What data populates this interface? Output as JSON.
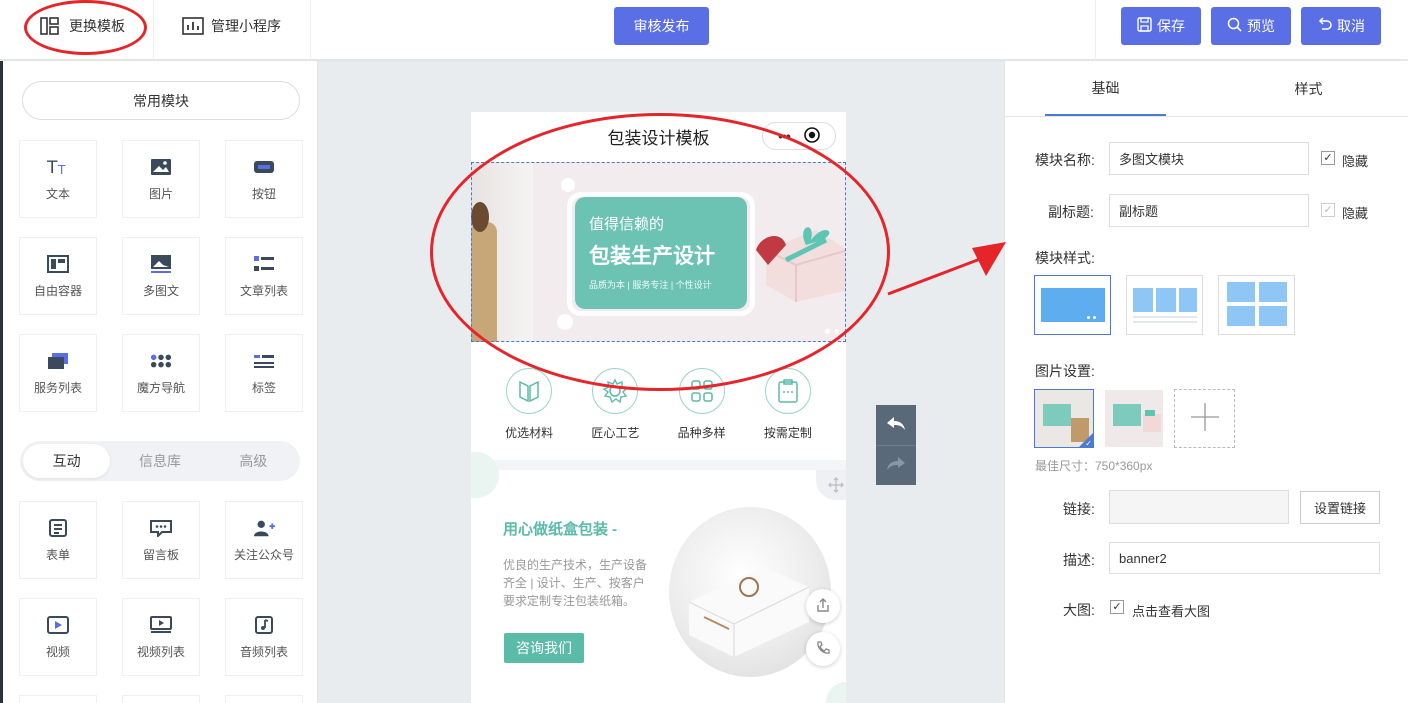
{
  "topbar": {
    "change_template": "更换模板",
    "manage_miniapp": "管理小程序",
    "publish": "审核发布",
    "save": "保存",
    "preview": "预览",
    "cancel": "取消"
  },
  "left": {
    "common_modules": "常用模块",
    "basic_items": [
      {
        "label": "文本",
        "icon": "text-icon"
      },
      {
        "label": "图片",
        "icon": "image-icon"
      },
      {
        "label": "按钮",
        "icon": "button-icon"
      },
      {
        "label": "自由容器",
        "icon": "container-icon"
      },
      {
        "label": "多图文",
        "icon": "multi-image-icon"
      },
      {
        "label": "文章列表",
        "icon": "article-list-icon"
      },
      {
        "label": "服务列表",
        "icon": "service-list-icon"
      },
      {
        "label": "魔方导航",
        "icon": "grid-nav-icon"
      },
      {
        "label": "标签",
        "icon": "tag-icon"
      }
    ],
    "segments": [
      "互动",
      "信息库",
      "高级"
    ],
    "interactive_items": [
      {
        "label": "表单",
        "icon": "form-icon"
      },
      {
        "label": "留言板",
        "icon": "message-board-icon"
      },
      {
        "label": "关注公众号",
        "icon": "follow-account-icon"
      },
      {
        "label": "视频",
        "icon": "video-icon"
      },
      {
        "label": "视频列表",
        "icon": "video-list-icon"
      },
      {
        "label": "音频列表",
        "icon": "audio-list-icon"
      }
    ]
  },
  "phone": {
    "title": "包装设计模板",
    "banner": {
      "line1": "值得信赖的",
      "line2": "包装生产设计",
      "line3": "品质为本 | 服务专注 | 个性设计"
    },
    "nav": [
      "优选材料",
      "匠心工艺",
      "品种多样",
      "按需定制"
    ],
    "promo": {
      "title": "用心做纸盒包装 -",
      "desc": "优良的生产技术，生产设备齐全 | 设计、生产、按客户要求定制专注包装纸箱。",
      "button": "咨询我们"
    }
  },
  "right": {
    "tabs": [
      "基础",
      "样式"
    ],
    "module_name_label": "模块名称:",
    "module_name_value": "多图文模块",
    "hide_label": "隐藏",
    "subtitle_label": "副标题:",
    "subtitle_value": "副标题",
    "hide_label2": "隐藏",
    "style_label": "模块样式:",
    "image_label": "图片设置:",
    "size_hint": "最佳尺寸：750*360px",
    "link_label": "链接:",
    "set_link": "设置链接",
    "desc_label": "描述:",
    "desc_value": "banner2",
    "bigimg_label": "大图:",
    "bigimg_check": "点击查看大图"
  },
  "colors": {
    "accent": "#5a6ee6",
    "teal": "#5bbba9",
    "annotation": "#e5252a",
    "selection": "#4a7bd0"
  }
}
